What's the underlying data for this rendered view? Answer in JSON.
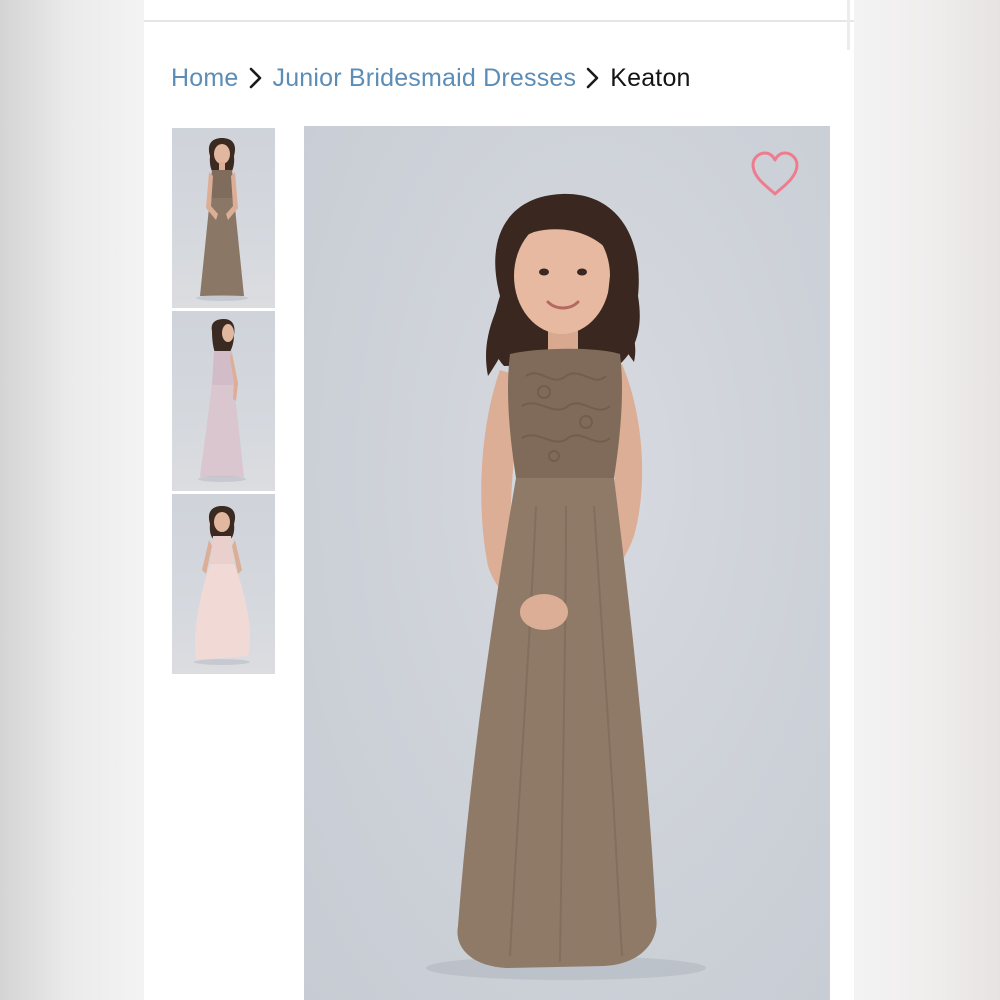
{
  "breadcrumb": {
    "items": [
      {
        "label": "Home",
        "link": true
      },
      {
        "label": "Junior Bridesmaid Dresses",
        "link": true
      },
      {
        "label": "Keaton",
        "link": false
      }
    ]
  },
  "gallery": {
    "thumbnails": [
      {
        "dress_color": "#8a7766"
      },
      {
        "dress_color": "#d9c6cf"
      },
      {
        "dress_color": "#f1d9d6"
      }
    ],
    "main_dress_color": "#8f7a68"
  },
  "favorite": {
    "icon": "heart-outline-icon",
    "color": "#ee7c8e"
  },
  "colors": {
    "link": "#5b8db6",
    "current": "#141414"
  }
}
